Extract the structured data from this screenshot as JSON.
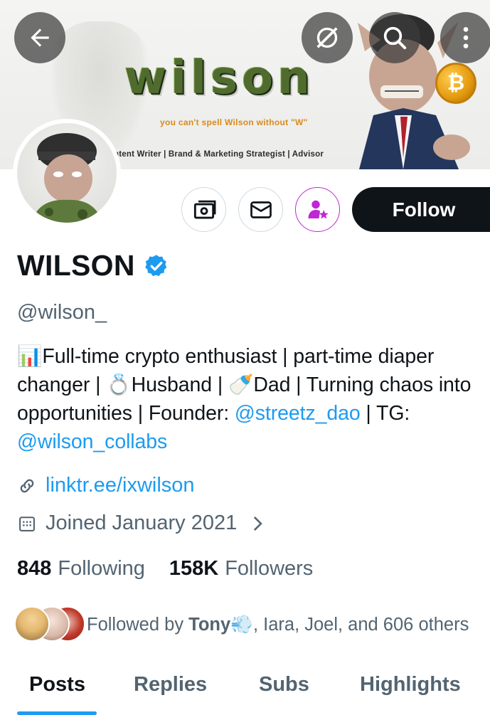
{
  "banner": {
    "logo_text": "wilson",
    "tagline": "you can't spell Wilson without \"W\"",
    "roles": "ntent Writer | Brand & Marketing Strategist | Advisor",
    "coin_symbol": "₿"
  },
  "top_bar": {
    "back_icon": "arrow-left-icon",
    "grok_icon": "grok-slash-icon",
    "search_icon": "search-icon",
    "more_icon": "more-vertical-icon"
  },
  "actions": {
    "tip_icon": "money-icon",
    "message_icon": "envelope-icon",
    "subscribe_icon": "person-star-icon",
    "follow_label": "Follow"
  },
  "profile": {
    "display_name": "WILSON",
    "handle": "@wilson_",
    "bio": {
      "emoji_chart": "📊",
      "part1": "Full-time crypto enthusiast | part-time diaper changer | ",
      "emoji_ring": "💍",
      "part2": "Husband | ",
      "emoji_bottle": "🍼",
      "part3": "Dad | Turning chaos into opportunities | Founder: ",
      "mention1": "@streetz_dao",
      "part4": " | TG: ",
      "mention2": "@wilson_collabs"
    },
    "link": "linktr.ee/ixwilson",
    "joined": "Joined January 2021"
  },
  "stats": {
    "following_count": "848",
    "following_label": "Following",
    "followers_count": "158K",
    "followers_label": "Followers"
  },
  "followed_by": {
    "prefix": "Followed by ",
    "first_name": "Tony",
    "emoji": "💨",
    "rest": ", Iara, Joel, and 606 others"
  },
  "tabs": {
    "posts": "Posts",
    "replies": "Replies",
    "subs": "Subs",
    "highlights": "Highlights"
  },
  "colors": {
    "accent": "#1d9bf0",
    "text": "#0f1419",
    "secondary": "#536471",
    "subscribe": "#c026d3"
  }
}
